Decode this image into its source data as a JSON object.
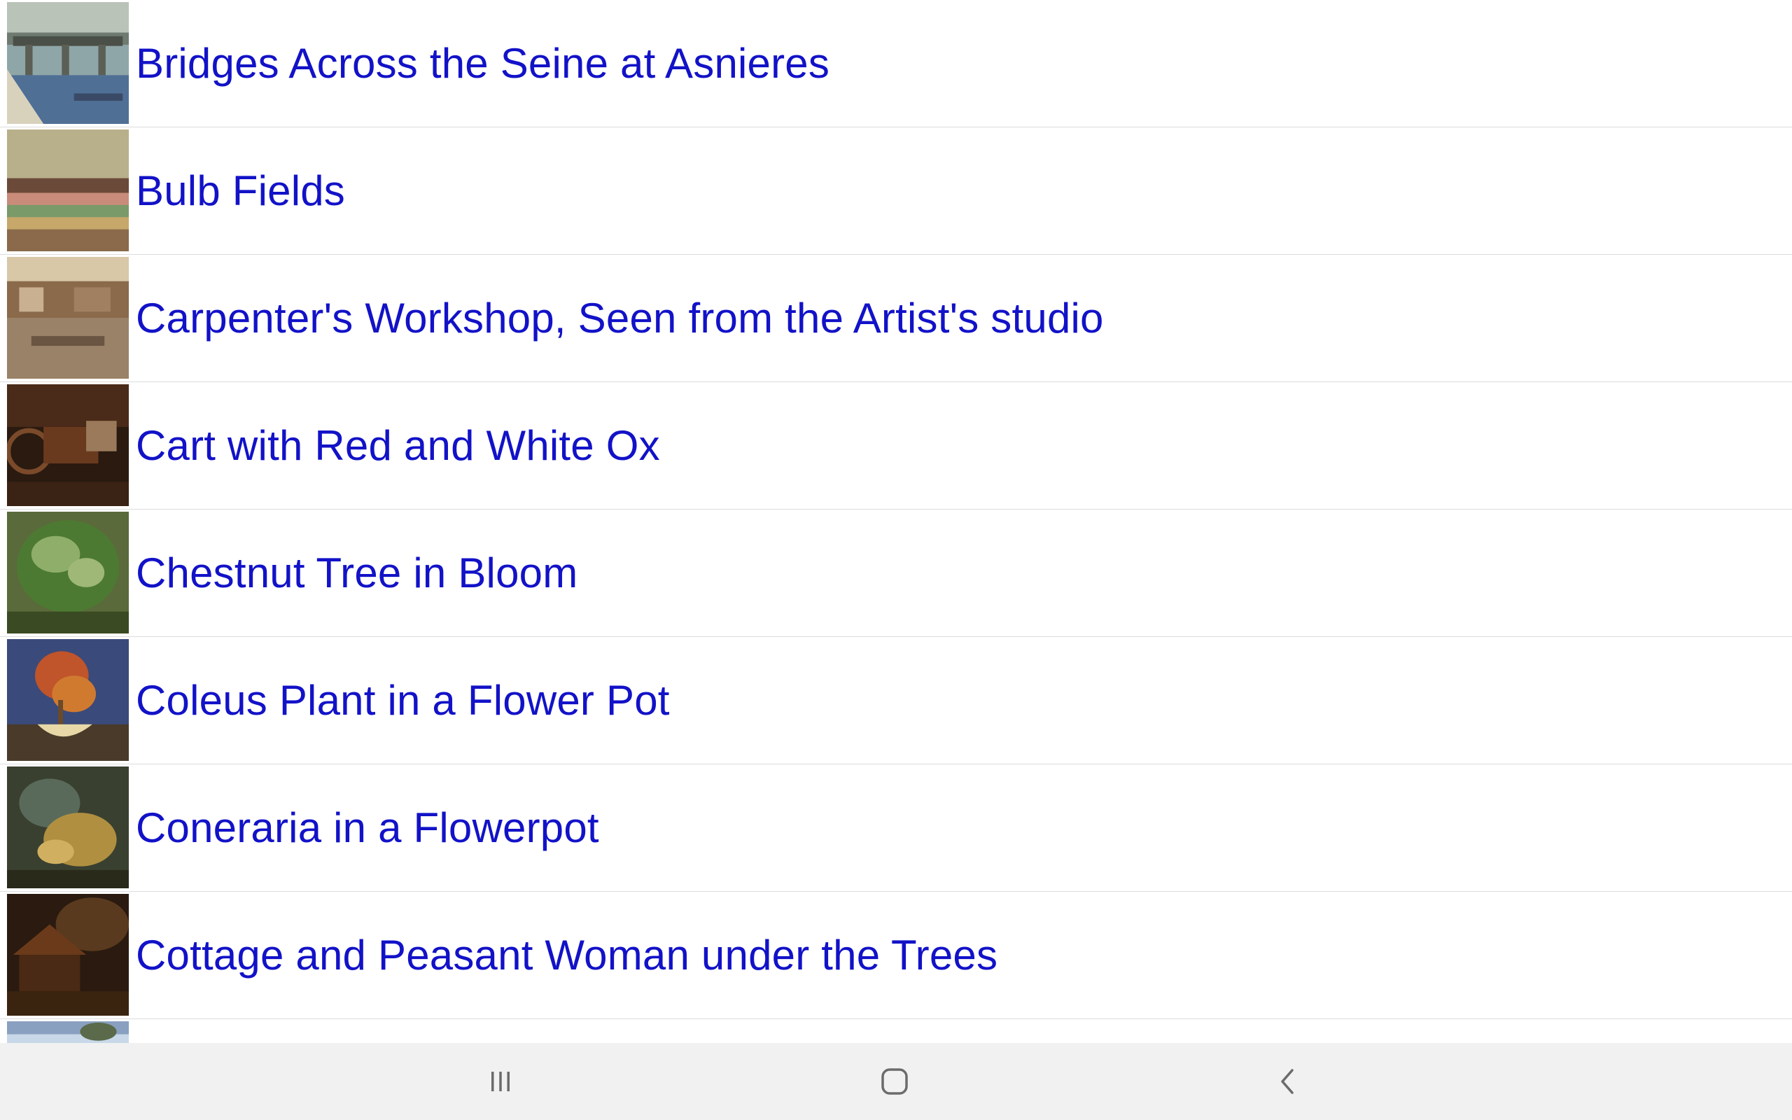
{
  "list": {
    "items": [
      {
        "title": "Bridges Across the Seine at Asnieres"
      },
      {
        "title": "Bulb Fields"
      },
      {
        "title": "Carpenter's Workshop, Seen from the Artist's studio"
      },
      {
        "title": "Cart with Red and White Ox"
      },
      {
        "title": "Chestnut Tree in Bloom"
      },
      {
        "title": "Coleus Plant in a Flower Pot"
      },
      {
        "title": "Coneraria in a Flowerpot"
      },
      {
        "title": "Cottage and Peasant Woman under the Trees"
      }
    ]
  },
  "navbar": {
    "recents_icon": "recent-apps-icon",
    "home_icon": "home-icon",
    "back_icon": "back-icon"
  },
  "colors": {
    "link_text": "#1212c8",
    "divider": "#dcdcdc",
    "navbar_bg": "#f1f1f1",
    "nav_icon": "#6b6b6b"
  }
}
